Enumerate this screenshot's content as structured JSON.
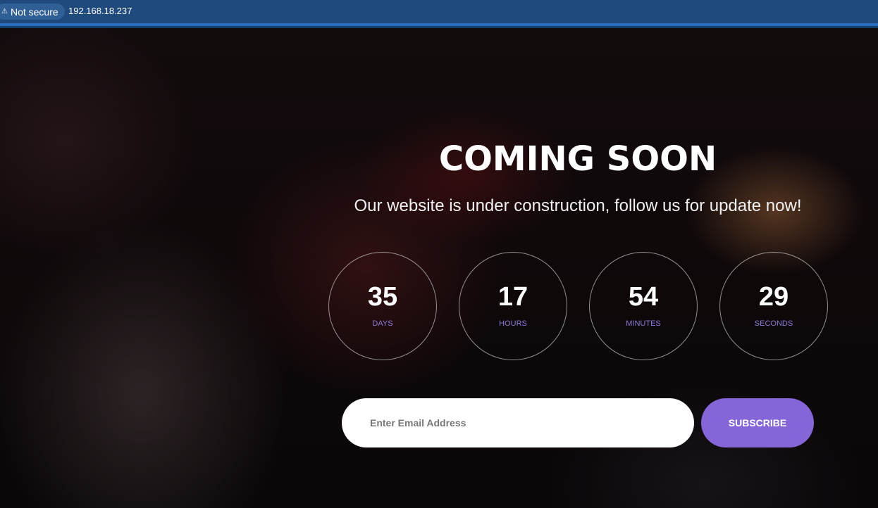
{
  "browser": {
    "security_label": "Not secure",
    "warning_icon": "⚠",
    "url": "192.168.18.237"
  },
  "hero": {
    "title": "COMING SOON",
    "subtitle": "Our website is under construction, follow us for update now!"
  },
  "countdown": {
    "days": {
      "value": "35",
      "label": "DAYS"
    },
    "hours": {
      "value": "17",
      "label": "HOURS"
    },
    "minutes": {
      "value": "54",
      "label": "MINUTES"
    },
    "seconds": {
      "value": "29",
      "label": "SECONDS"
    }
  },
  "subscribe": {
    "email_placeholder": "Enter Email Address",
    "email_value": "",
    "button_label": "SUBSCRIBE"
  },
  "colors": {
    "accent": "#8566d9",
    "browser_bar": "#1f4a7d",
    "label_text": "#8d7bd6"
  }
}
